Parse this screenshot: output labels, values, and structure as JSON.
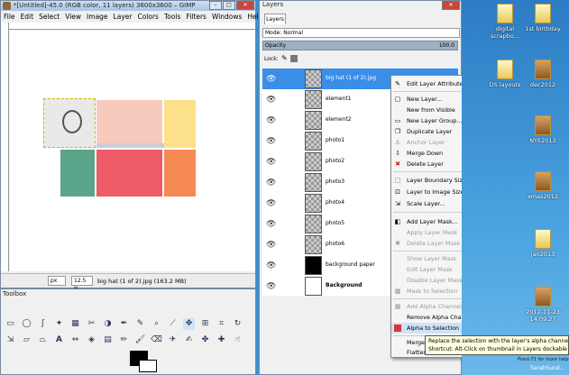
{
  "gimp": {
    "title": "*[Untitled]-45.0 (RGB color, 11 layers) 3600x3600 – GIMP",
    "menus": [
      "File",
      "Edit",
      "Select",
      "View",
      "Image",
      "Layer",
      "Colors",
      "Tools",
      "Filters",
      "Windows",
      "Help"
    ],
    "status": {
      "unit": "px",
      "zoom": "12.5 %",
      "info": "big hat (1 of 2).jpg (163.2 MB)"
    }
  },
  "toolbox": {
    "title": "Toolbox"
  },
  "layers_dock": {
    "title": "Layers",
    "tab": "Layers",
    "mode_label": "Mode: Normal",
    "opacity_label": "Opacity",
    "opacity_value": "100.0",
    "lock_label": "Lock:",
    "layers": [
      {
        "name": "big hat (1 of 2).jpg",
        "selected": true
      },
      {
        "name": "element1"
      },
      {
        "name": "element2"
      },
      {
        "name": "photo1"
      },
      {
        "name": "photo2"
      },
      {
        "name": "photo3"
      },
      {
        "name": "photo4"
      },
      {
        "name": "photo5"
      },
      {
        "name": "photo6"
      },
      {
        "name": "background paper"
      },
      {
        "name": "Background"
      }
    ]
  },
  "context_menu": {
    "items": [
      {
        "label": "Edit Layer Attributes...",
        "icon": "edit-icon",
        "disabled": false
      },
      {
        "label": "New Layer...",
        "icon": "new-layer-icon",
        "disabled": false
      },
      {
        "label": "New from Visible",
        "icon": "",
        "disabled": false
      },
      {
        "label": "New Layer Group...",
        "icon": "folder-icon",
        "disabled": false
      },
      {
        "label": "Duplicate Layer",
        "icon": "duplicate-icon",
        "disabled": false
      },
      {
        "label": "Anchor Layer",
        "icon": "anchor-icon",
        "disabled": true
      },
      {
        "label": "Merge Down",
        "icon": "merge-icon",
        "disabled": false
      },
      {
        "label": "Delete Layer",
        "icon": "delete-icon",
        "disabled": false
      },
      {
        "label": "Layer Boundary Size...",
        "icon": "boundary-icon",
        "disabled": false
      },
      {
        "label": "Layer to Image Size",
        "icon": "image-size-icon",
        "disabled": false
      },
      {
        "label": "Scale Layer...",
        "icon": "scale-icon",
        "disabled": false
      },
      {
        "label": "Add Layer Mask...",
        "icon": "mask-icon",
        "disabled": false
      },
      {
        "label": "Apply Layer Mask",
        "icon": "",
        "disabled": true
      },
      {
        "label": "Delete Layer Mask",
        "icon": "delete-mask-icon",
        "disabled": true
      },
      {
        "label": "Show Layer Mask",
        "icon": "",
        "disabled": true
      },
      {
        "label": "Edit Layer Mask",
        "icon": "",
        "disabled": true
      },
      {
        "label": "Disable Layer Mask",
        "icon": "",
        "disabled": true
      },
      {
        "label": "Mask to Selection",
        "icon": "mask-selection-icon",
        "disabled": true
      },
      {
        "label": "Add Alpha Channel",
        "icon": "alpha-icon",
        "disabled": true
      },
      {
        "label": "Remove Alpha Channel",
        "icon": "",
        "disabled": false
      },
      {
        "label": "Alpha to Selection",
        "icon": "alpha-selection-icon",
        "disabled": false,
        "highlighted": true
      },
      {
        "label": "Merge",
        "icon": "",
        "disabled": false
      },
      {
        "label": "Flatten",
        "icon": "",
        "disabled": false
      }
    ],
    "tooltip_line1": "Replace the selection with the layer's alpha channel",
    "tooltip_line2": "Shortcut: Alt-Click on thumbnail in Layers dockable",
    "tooltip_help": "Press F1 for more help"
  },
  "desktop": {
    "icons": [
      {
        "label": "digital scrapbo..."
      },
      {
        "label": "1st birthday"
      },
      {
        "label": "DS layouts"
      },
      {
        "label": "dec2012"
      },
      {
        "label": "NYE2012"
      },
      {
        "label": "xmas2012"
      },
      {
        "label": "jan2013"
      },
      {
        "label": "2012-11-23 14.09.27"
      }
    ],
    "user_label": "SarahSund..."
  }
}
